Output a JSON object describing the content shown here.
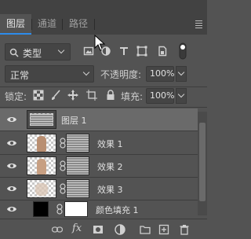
{
  "tabs": [
    {
      "label": "图层",
      "active": true
    },
    {
      "label": "通道",
      "active": false
    },
    {
      "label": "路径",
      "active": false
    }
  ],
  "filter": {
    "label": "类型",
    "icons": [
      "image-filter-icon",
      "adjustment-filter-icon",
      "type-filter-icon",
      "shape-filter-icon",
      "smart-object-filter-icon",
      "filter-toggle-icon"
    ]
  },
  "blend": {
    "mode": "正常",
    "opacity_label": "不透明度:",
    "opacity_value": "100%"
  },
  "lock": {
    "label": "锁定:",
    "fill_label": "填充:",
    "fill_value": "100%"
  },
  "layers": [
    {
      "name": "图层 1",
      "selected": true
    },
    {
      "name": "效果 1",
      "selected": false
    },
    {
      "name": "效果 2",
      "selected": false
    },
    {
      "name": "效果 3",
      "selected": false
    },
    {
      "name": "颜色填充 1",
      "selected": false
    }
  ],
  "bottom_icons": [
    "link-icon",
    "fx-icon",
    "mask-icon",
    "adjustment-icon",
    "group-folder-icon",
    "new-layer-icon",
    "trash-icon"
  ],
  "bottom": {
    "fx_label": "fx"
  }
}
